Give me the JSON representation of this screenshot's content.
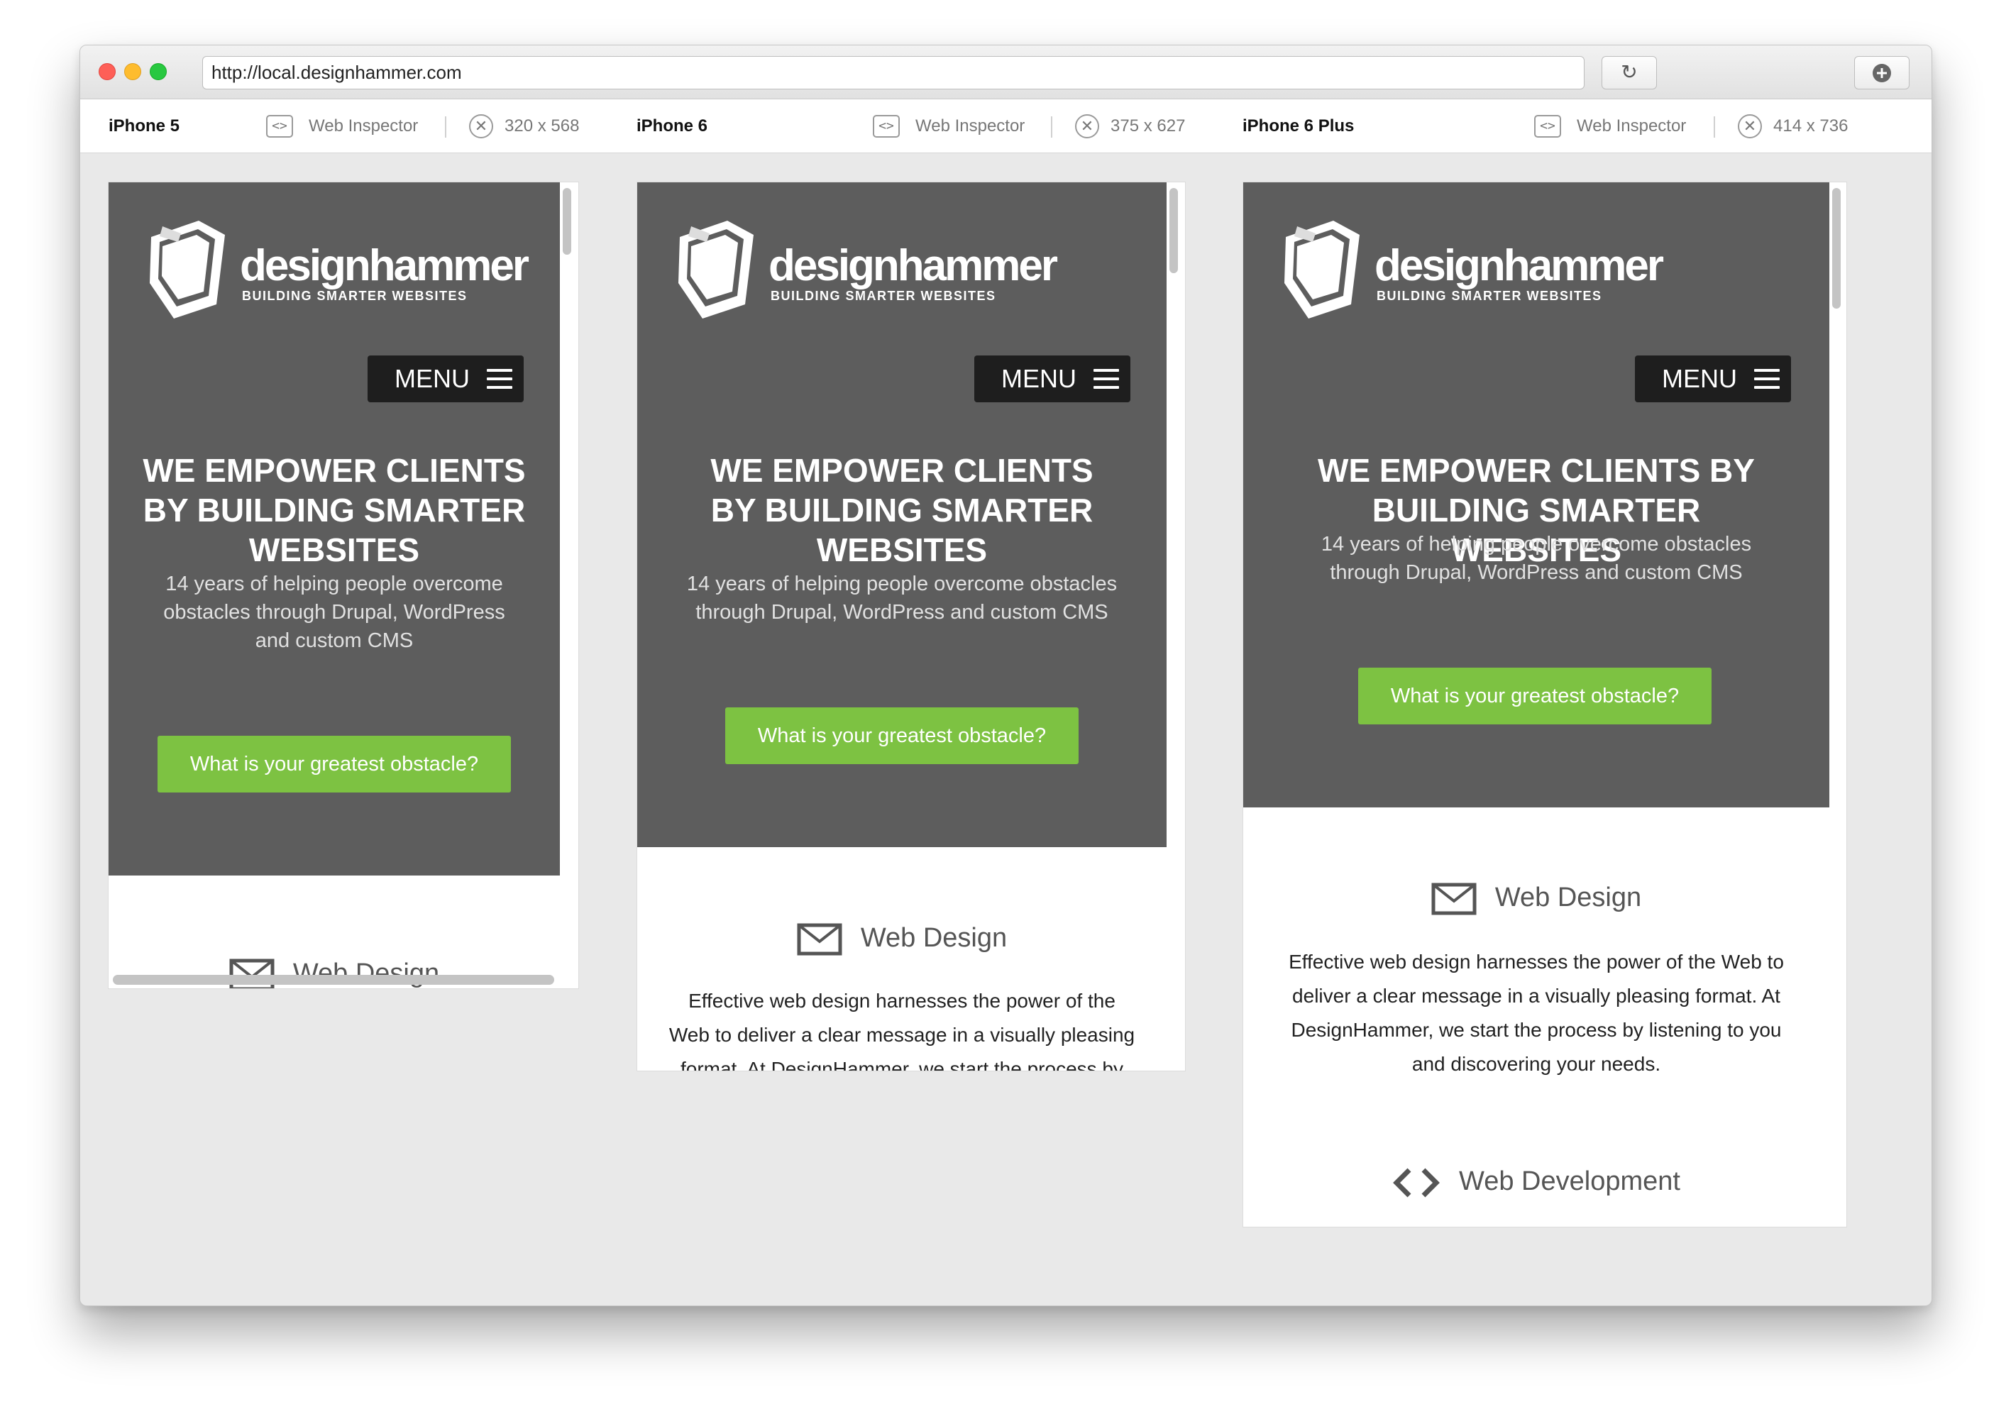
{
  "browser": {
    "url": "http://local.designhammer.com",
    "reload_icon": "reload-icon",
    "new_tab_icon": "plus-circle-icon"
  },
  "devices": [
    {
      "name": "iPhone 5",
      "inspector_label": "Web Inspector",
      "size": "320 x 568"
    },
    {
      "name": "iPhone 6",
      "inspector_label": "Web Inspector",
      "size": "375 x 627"
    },
    {
      "name": "iPhone 6 Plus",
      "inspector_label": "Web Inspector",
      "size": "414 x 736"
    }
  ],
  "site": {
    "brand": "designhammer",
    "tagline": "BUILDING SMARTER WEBSITES",
    "menu_label": "MENU",
    "headline": "WE EMPOWER CLIENTS BY BUILDING SMARTER WEBSITES",
    "subheadline": "14 years of helping people overcome obstacles through Drupal, WordPress and custom CMS",
    "cta_label": "What is your greatest obstacle?",
    "services": [
      {
        "title": "Web Design",
        "icon": "envelope-icon",
        "description": "Effective web design harnesses the power of the Web to deliver a clear message in a visually pleasing format. At DesignHammer, we start the process by listening to you and discovering your needs."
      },
      {
        "title": "Web Development",
        "icon": "code-brackets-icon"
      }
    ]
  },
  "colors": {
    "hero_bg": "#5d5d5d",
    "cta_green": "#7dc242",
    "menu_bg": "#1e1e1e"
  }
}
